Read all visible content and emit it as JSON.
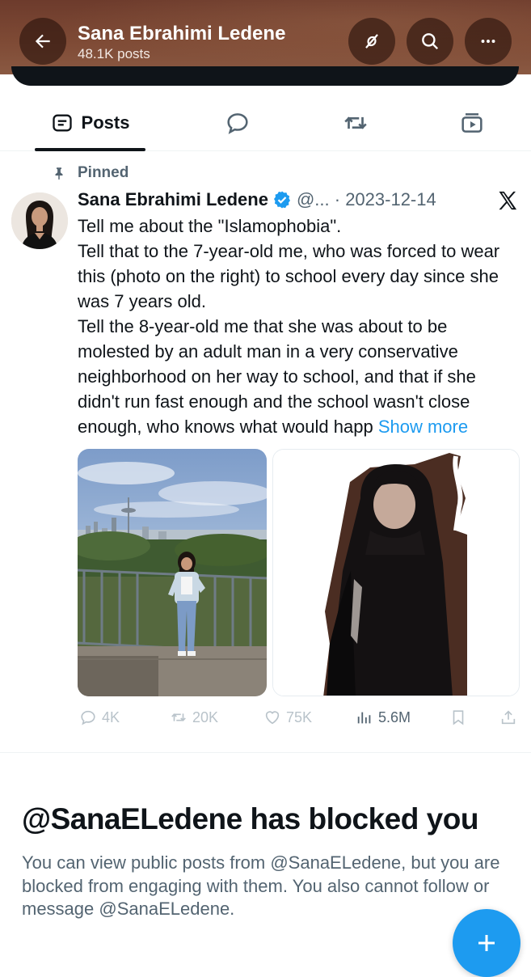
{
  "header": {
    "name": "Sana Ebrahimi Ledene",
    "posts_count": "48.1K posts",
    "icons": [
      "back-arrow-icon",
      "grok-icon",
      "search-icon",
      "more-icon"
    ]
  },
  "tabs": [
    {
      "label": "Posts",
      "icon": "posts-icon",
      "selected": true
    },
    {
      "label": "",
      "icon": "replies-icon",
      "selected": false
    },
    {
      "label": "",
      "icon": "repost-icon",
      "selected": false
    },
    {
      "label": "",
      "icon": "media-icon",
      "selected": false
    }
  ],
  "post": {
    "pinned_label": "Pinned",
    "author_name": "Sana Ebrahimi Ledene",
    "handle_date": "@... · 2023-12-14",
    "lines": [
      "Tell me about the \"Islamophobia\".",
      "Tell that to the 7-year-old me, who was forced to wear this (photo on the right) to school every day since she was 7 years old.",
      "Tell the 8-year-old me that she was about to be molested by an adult man in a very conservative neighborhood on her way to school, and that if she didn't run fast enough and the school wasn't close enough, who knows what would happ "
    ],
    "show_more": "Show more",
    "stats": {
      "replies": "4K",
      "reposts": "20K",
      "likes": "75K",
      "views": "5.6M"
    }
  },
  "blocked": {
    "title": "@SanaELedene has blocked you",
    "body": "You can view public posts from @SanaELedene, but you are blocked from engaging with them. You also cannot follow or message @SanaELedene."
  },
  "colors": {
    "accent": "#1d9bf0",
    "text": "#0f1419",
    "muted": "#536471",
    "header": "#7e4a35"
  }
}
